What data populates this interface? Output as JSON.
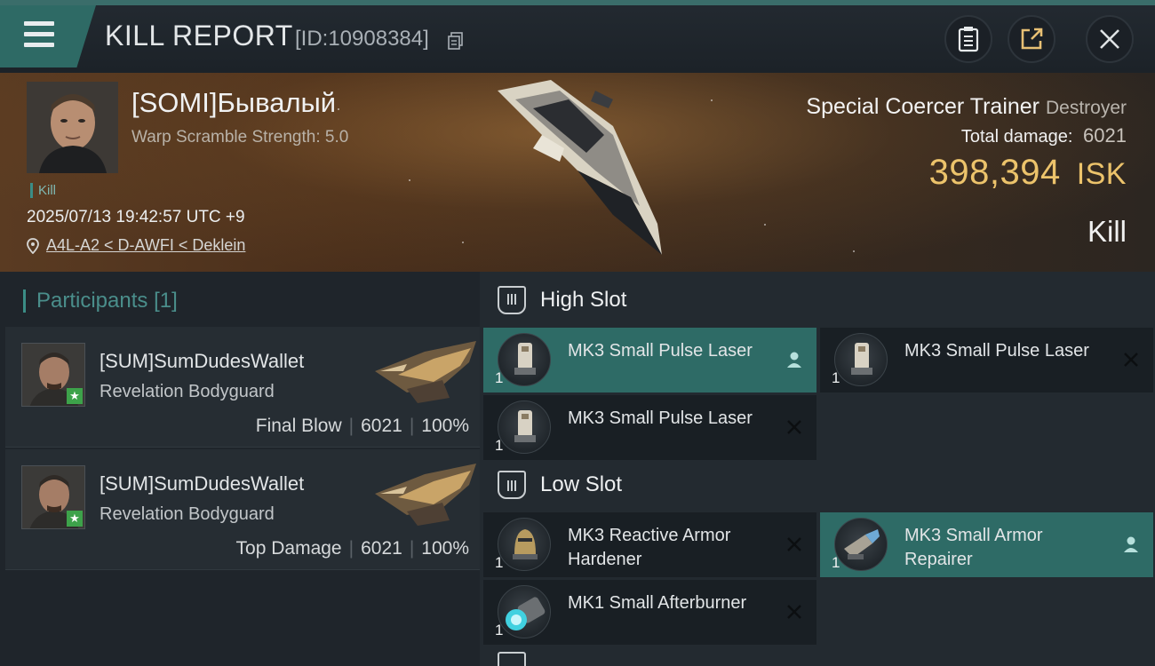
{
  "header": {
    "title": "KILL REPORT",
    "report_id": "[ID:10908384]"
  },
  "victim": {
    "name": "[SOMI]Бывалый",
    "warp_scramble": "Warp Scramble Strength: 5.0",
    "tag": "Kill",
    "datetime": "2025/07/13 19:42:57 UTC +9",
    "location": "A4L-A2 < D-AWFI < Deklein",
    "ship_name": "Special Coercer Trainer",
    "ship_class": "Destroyer",
    "total_damage_label": "Total damage:",
    "total_damage": "6021",
    "isk_value": "398,394",
    "isk_unit": "ISK",
    "result": "Kill"
  },
  "participants": {
    "label": "Participants",
    "count": "[1]",
    "items": [
      {
        "name": "[SUM]SumDudesWallet",
        "ship": "Revelation Bodyguard",
        "role": "Final Blow",
        "damage": "6021",
        "percent": "100%"
      },
      {
        "name": "[SUM]SumDudesWallet",
        "ship": "Revelation Bodyguard",
        "role": "Top Damage",
        "damage": "6021",
        "percent": "100%"
      }
    ]
  },
  "slots": {
    "high": {
      "label": "High Slot",
      "modules": [
        {
          "name": "MK3 Small Pulse Laser",
          "qty": "1",
          "state": "fitted"
        },
        {
          "name": "MK3 Small Pulse Laser",
          "qty": "1",
          "state": "destroyed"
        },
        {
          "name": "MK3 Small Pulse Laser",
          "qty": "1",
          "state": "destroyed"
        }
      ]
    },
    "low": {
      "label": "Low Slot",
      "modules": [
        {
          "name": "MK3 Reactive Armor Hardener",
          "qty": "1",
          "state": "destroyed"
        },
        {
          "name": "MK3 Small Armor Repairer",
          "qty": "1",
          "state": "fitted"
        },
        {
          "name": "MK1 Small Afterburner",
          "qty": "1",
          "state": "destroyed"
        }
      ]
    }
  },
  "colors": {
    "accent": "#2e6b66",
    "isk": "#ecc36b",
    "participants": "#4a8e8b"
  }
}
